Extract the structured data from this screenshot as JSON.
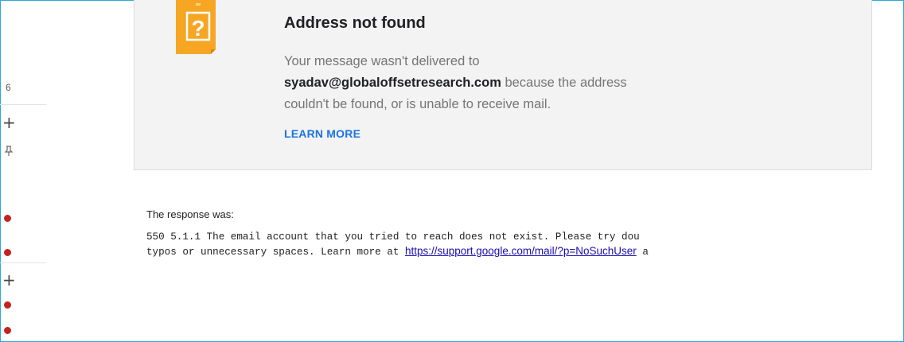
{
  "sidebar": {
    "count": "6",
    "plus_glyph": "+",
    "icons": [
      "plus-icon",
      "pin-icon",
      "plus-icon"
    ],
    "dot_color": "#c5221f"
  },
  "card": {
    "icon": "question-document-icon",
    "icon_glyph": "?",
    "title": "Address not found",
    "body_line1": "Your message wasn't delivered to",
    "address": "syadav@globaloffsetresearch.com",
    "body_after_address": " because the address",
    "body_line3": "couldn't be found, or is unable to receive mail.",
    "learn_more": "LEARN MORE"
  },
  "response": {
    "label": "The response was:",
    "line1": "550 5.1.1 The email account that you tried to reach does not exist. Please try dou",
    "line2_prefix": "typos or unnecessary spaces. Learn more at ",
    "link": "https://support.google.com/mail/?p=NoSuchUser",
    "line2_suffix": " a"
  },
  "colors": {
    "frame": "#2fa8dd",
    "link": "#1a73e8",
    "icon_orange": "#f6a623"
  }
}
